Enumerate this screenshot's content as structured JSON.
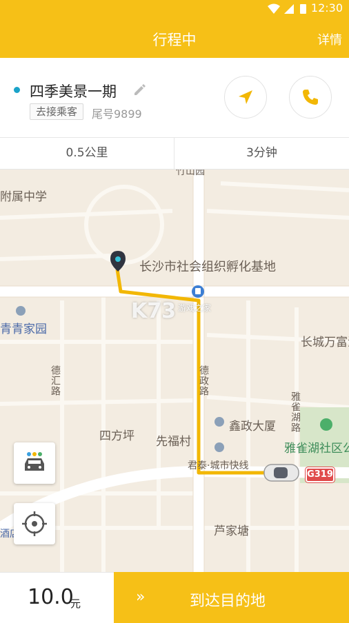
{
  "status_bar": {
    "time": "12:30"
  },
  "header": {
    "title": "行程中",
    "detail": "详情"
  },
  "trip": {
    "destination": "四季美景一期",
    "status_tag": "去接乘客",
    "tail_number": "尾号9899"
  },
  "metrics": {
    "distance": "0.5公里",
    "duration": "3分钟"
  },
  "map": {
    "labels": {
      "school": "附属中学",
      "tianxin": "竹山园",
      "incubator": "长沙市社会组织孵化基地",
      "qingqing": "青青家园",
      "changcheng": "长城万富汇",
      "dezheng": "德政路",
      "dehui": "德汇路",
      "yaque": "雅雀湖路",
      "xinzheng": "鑫政大厦",
      "sifangping": "四方坪",
      "xianfucun": "先福村",
      "yaque_community": "雅雀湖社区公",
      "juntai": "君泰·城市快线",
      "lujiatang": "芦家塘",
      "hotel": "酒店",
      "road_shield": "G319"
    },
    "watermark": "K73",
    "watermark_sub": "游戏之家"
  },
  "bottom": {
    "fare_amount": "10.0",
    "fare_unit": "元",
    "arrive_chevrons": "»",
    "arrive_label": "到达目的地"
  },
  "colors": {
    "accent": "#f6c017",
    "route": "#f2b705",
    "dot": "#1aa3c9",
    "shield": "#e04b4b"
  }
}
